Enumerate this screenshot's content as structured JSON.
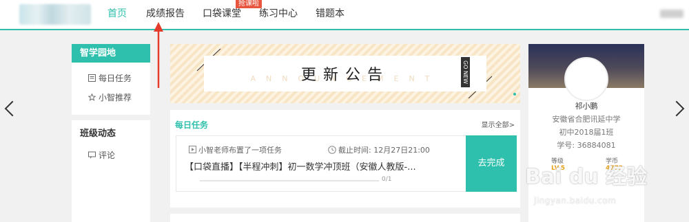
{
  "nav": {
    "items": [
      {
        "label": "首页"
      },
      {
        "label": "成绩报告"
      },
      {
        "label": "口袋课堂"
      },
      {
        "label": "练习中心"
      },
      {
        "label": "错题本"
      }
    ],
    "badge": "抢课啦",
    "active_color": "#2ec0ad"
  },
  "sidebar": {
    "section1_title": "智学园地",
    "items": [
      {
        "label": "每日任务",
        "icon": "document-icon"
      },
      {
        "label": "小智推荐",
        "icon": "star-icon"
      }
    ],
    "section2_title": "班级动态",
    "comment_label": "评论",
    "comment_icon": "comment-icon"
  },
  "banner": {
    "title": "更新公告",
    "subtitle": "ANNOUNCEMENT",
    "tag": "GO NEW"
  },
  "tasks": {
    "title": "每日任务",
    "show_all": "显示全部>",
    "item": {
      "assigner": "小智老师布置了一项任务",
      "deadline": "截止时间:  12月27日21:00",
      "course": "【口袋直播】【半程冲刺】初一数学冲顶班（安徽人教版-...",
      "progress_text": "0/1",
      "progress": 0,
      "action": "去完成"
    }
  },
  "profile": {
    "name": "祁小鹏",
    "school": "安徽省合肥讯延中学",
    "class": "初中2018届1班",
    "student_id": "学号:  36884081",
    "level_label": "等级",
    "level_value": "LV.5",
    "coin_label": "学币",
    "coin_value": "4772"
  },
  "watermark": {
    "brand": "Bai du 经验",
    "url": "jingyan.baidu.com"
  }
}
